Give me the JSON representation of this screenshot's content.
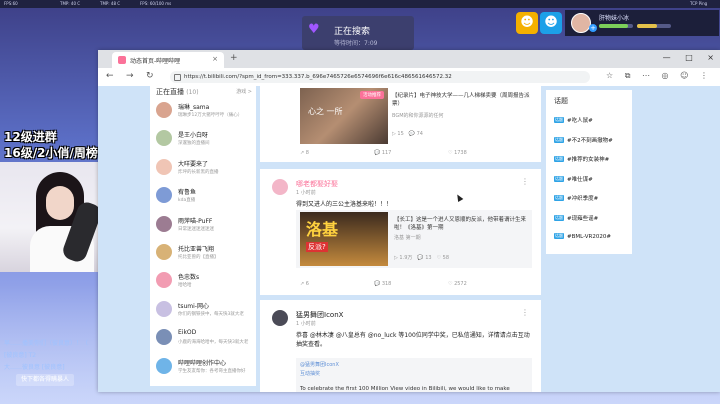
{
  "status_bar": {
    "items": [
      "FPS:60",
      "TMP: 40 C",
      "TMP: 48 C",
      "FPS: 60/100 ms",
      "TCP Ping"
    ]
  },
  "search_widget": {
    "title": "正在搜索",
    "sub": "等待时间：7:09"
  },
  "user_panel": {
    "name": "肝物妹小冰",
    "plus": "+",
    "bar_levels": [
      0.85,
      0.6
    ]
  },
  "overlay": {
    "line1": "12级进群",
    "line2": "16级/2小俏/周榜前三房管",
    "chat": [
      "早……播美你们（彼良意）！（",
      "[彼良意] T2",
      "大……彼良意 [彼良意]"
    ],
    "chat_button": "快下都各得瞒暴人"
  },
  "browser": {
    "tab_title": "动态首页-哔哩哔哩",
    "tab_close": "×",
    "new_tab": "+",
    "window_controls": [
      "—",
      "□",
      "×"
    ],
    "nav": {
      "back": "←",
      "forward": "→",
      "reload": "↻"
    },
    "url": "https://t.bilibili.com/?spm_id_from=333.337.b_696e7465726e6574696f6e616c486561646572.32",
    "toolbar_icons": [
      "☆",
      "⧉",
      "⋯",
      "◎",
      "☺",
      "⋮"
    ]
  },
  "live": {
    "header": "正在直播",
    "count": "(10)",
    "more": "游戏 >",
    "items": [
      {
        "name": "瑞琳_sama",
        "desc": "瑞琳步12万大猪哼哼哼（痛心）",
        "color": "#d9a48f"
      },
      {
        "name": "是王小白呀",
        "desc": "深邃独的直播间",
        "color": "#b3c8a2"
      },
      {
        "name": "大咩要来了",
        "desc": "炸坪的长新黑的直播",
        "color": "#f0c5b5"
      },
      {
        "name": "宥鲁鱼",
        "desc": "kda直播",
        "color": "#7e9bd6"
      },
      {
        "name": "雨萍喵-PuFF",
        "desc": "日常迷迷迷迷迷迷",
        "color": "#9c7c92"
      },
      {
        "name": "托比亚兽飞翔",
        "desc": "托比亚兽的【直播】",
        "color": "#d8b276"
      },
      {
        "name": "色忠数s",
        "desc": "哈哈哈",
        "color": "#f29cb2"
      },
      {
        "name": "tsumi-网心",
        "desc": "你们的钢铁侠中，每天快3就大老",
        "color": "#c8c0e2"
      },
      {
        "name": "EikOD",
        "desc": "小鹿的海海哈哈中，每天快3就大老",
        "color": "#7a8fb6"
      },
      {
        "name": "哔哩哔哩创作中心",
        "desc": "学生友友帮你：各考哥主直播你好",
        "color": "#6fb4e8"
      }
    ]
  },
  "feed": {
    "card1": {
      "image_overlay": "心之 一所",
      "tag": "活动推荐",
      "title": "【纪录片】电子神技大学——几人梯梯卖要（周周报告派票）",
      "source": "BGM的和你源源的任何",
      "stats": [
        "▷ 15",
        "💬 74"
      ],
      "actions": [
        "↗ 8",
        "💬 117",
        "♡ 1738"
      ]
    },
    "card2": {
      "name": "哪老都娶好娶",
      "time": "1 小时前",
      "text": "得到又进人的三公主洛基来啦！！！",
      "video_title_big": "洛基",
      "video_badge": "反派?",
      "video_text": "【长工】这是一个进人又恩顺的反派，他带着谓计生来啦！《洛基》第一期",
      "video_sub": "洛基 第一期",
      "video_stats": [
        "▷ 1.9万",
        "💬 13",
        "♡ 58"
      ],
      "actions": [
        "↗ 6",
        "💬 318",
        "♡ 2572"
      ]
    },
    "card3": {
      "name": "猛男舞团IconX",
      "time": "1 小时前",
      "text": "恭喜 @林木凄 @八皇总有 @no_luck 等100位同学中奖，已私信通知，详情请点击互动抽奖查看。",
      "repost_name": "@猛男舞团IconX",
      "repost_tag": "互动抽奖",
      "repost_text": "To celebrate the first 100 Million View video in Bilibili, we would like to make"
    }
  },
  "topics": {
    "header": "话题",
    "tag": "话题",
    "items": [
      "#吃人鼠#",
      "#不2不刻画撤物#",
      "#推荐的女装神#",
      "#唯仕谋#",
      "#冲织季度#",
      "#现雍些谣#",
      "#BML-VR2020#"
    ]
  }
}
